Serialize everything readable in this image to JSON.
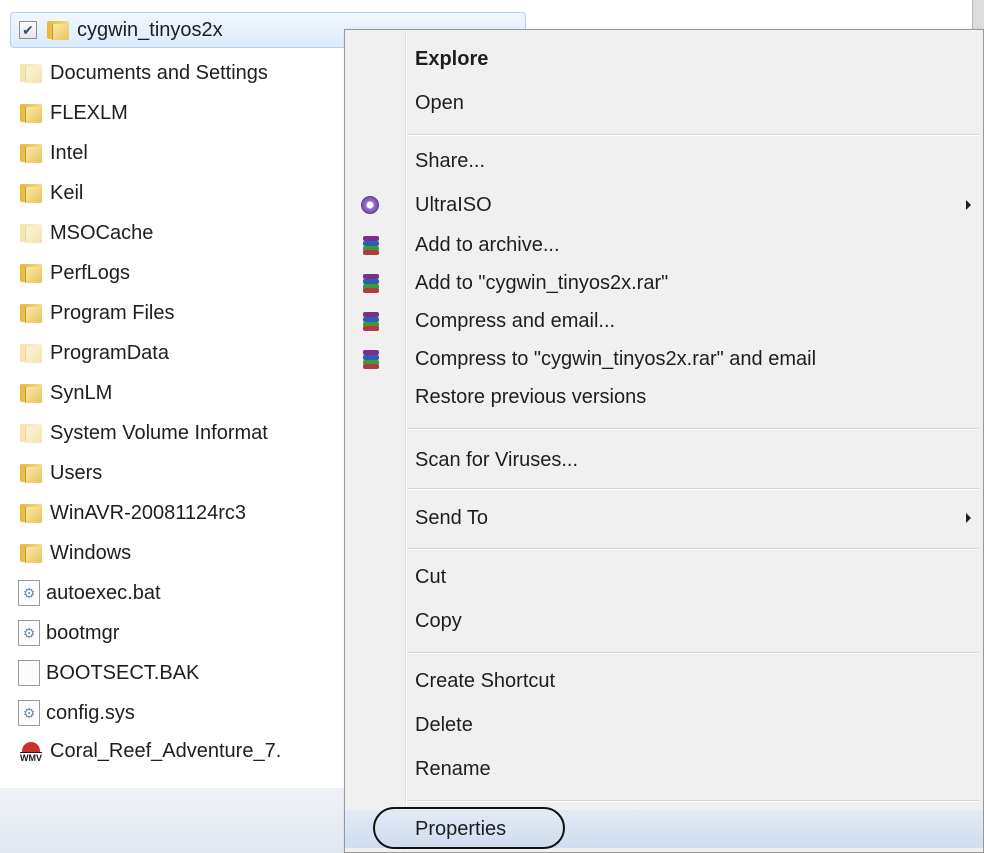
{
  "explorer": {
    "selected_folder": "cygwin_tinyos2x",
    "items": [
      {
        "name": "Documents and Settings",
        "type": "folder-ghost"
      },
      {
        "name": "FLEXLM",
        "type": "folder"
      },
      {
        "name": "Intel",
        "type": "folder"
      },
      {
        "name": "Keil",
        "type": "folder"
      },
      {
        "name": "MSOCache",
        "type": "folder-ghost"
      },
      {
        "name": "PerfLogs",
        "type": "folder"
      },
      {
        "name": "Program Files",
        "type": "folder"
      },
      {
        "name": "ProgramData",
        "type": "folder-ghost"
      },
      {
        "name": "SynLM",
        "type": "folder"
      },
      {
        "name": "System Volume Informat",
        "type": "folder-ghost"
      },
      {
        "name": "Users",
        "type": "folder"
      },
      {
        "name": "WinAVR-20081124rc3",
        "type": "folder"
      },
      {
        "name": "Windows",
        "type": "folder"
      },
      {
        "name": "autoexec.bat",
        "type": "system-file"
      },
      {
        "name": "bootmgr",
        "type": "system-file"
      },
      {
        "name": "BOOTSECT.BAK",
        "type": "file"
      },
      {
        "name": "config.sys",
        "type": "system-file"
      },
      {
        "name": "Coral_Reef_Adventure_7.",
        "type": "media-file"
      }
    ]
  },
  "context_menu": {
    "explore": "Explore",
    "open": "Open",
    "share": "Share...",
    "ultraiso": "UltraISO",
    "add_to_archive": "Add to archive...",
    "add_to_rar": "Add to \"cygwin_tinyos2x.rar\"",
    "compress_email": "Compress and email...",
    "compress_to_rar_email": "Compress to \"cygwin_tinyos2x.rar\" and email",
    "restore_previous": "Restore previous versions",
    "scan_viruses": "Scan for Viruses...",
    "send_to": "Send To",
    "cut": "Cut",
    "copy": "Copy",
    "create_shortcut": "Create Shortcut",
    "delete": "Delete",
    "rename": "Rename",
    "properties": "Properties"
  },
  "icons": {
    "ultraiso": "cd-icon",
    "rar": "winrar-icon",
    "folder": "folder-icon",
    "checkbox": "checkbox-checked"
  },
  "colors": {
    "selection_bg": "#dcebfb",
    "menu_bg": "#f0f0f0",
    "folder": "#e6b840"
  }
}
